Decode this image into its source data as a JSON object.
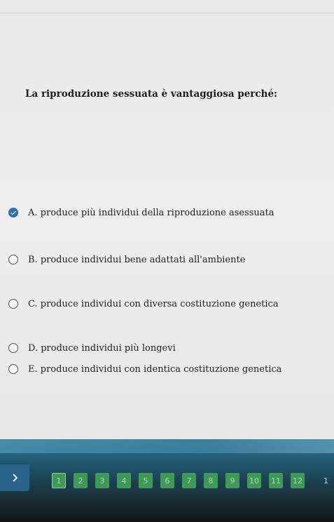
{
  "question": {
    "text": "La riproduzione sessuata è vantaggiosa perché:"
  },
  "options": [
    {
      "label": "A. produce più individui della riproduzione asessuata",
      "selected": true
    },
    {
      "label": "B. produce individui bene adattati all'ambiente",
      "selected": false
    },
    {
      "label": "C. produce individui con diversa costituzione genetica",
      "selected": false
    },
    {
      "label": "D. produce individui più longevi",
      "selected": false
    },
    {
      "label": "E. produce individui con identica costituzione genetica",
      "selected": false
    }
  ],
  "navigation": {
    "next_icon": "chevron-right-icon",
    "pages": [
      "1",
      "2",
      "3",
      "4",
      "5",
      "6",
      "7",
      "8",
      "9",
      "10",
      "11",
      "12"
    ],
    "truncated_page": "1",
    "current_page": "1"
  },
  "colors": {
    "selected_radio": "#2f6fb0",
    "page_button": "#3f9a57",
    "bottom_bar": "#1f566d"
  }
}
